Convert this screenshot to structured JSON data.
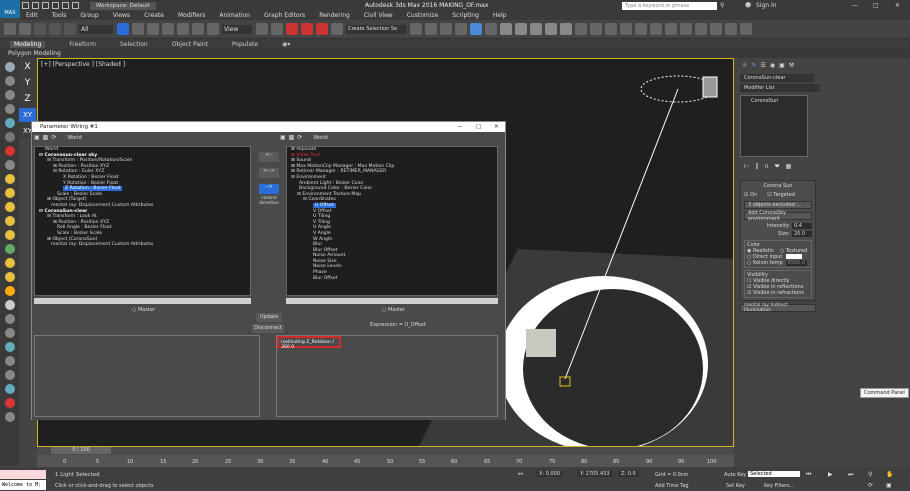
{
  "app": {
    "logo": "MAX",
    "title": "Autodesk 3ds Max 2016     MAKING_OF.max",
    "workspace": "Workspace: Default",
    "search_placeholder": "Type a keyword or phrase",
    "sign_in": "Sign In"
  },
  "menu": [
    "Edit",
    "Tools",
    "Group",
    "Views",
    "Create",
    "Modifiers",
    "Animation",
    "Graph Editors",
    "Rendering",
    "Civil View",
    "Customize",
    "Scripting",
    "Help"
  ],
  "toolbar": {
    "selection_filter": "All",
    "view_dropdown": "View",
    "selection_set": "Create Selection Se"
  },
  "ribbon": {
    "tabs": [
      "Modeling",
      "Freeform",
      "Selection",
      "Object Paint",
      "Populate"
    ],
    "sub": "Polygon Modeling"
  },
  "axes": [
    "X",
    "Y",
    "Z",
    "XY",
    "XY"
  ],
  "viewport": {
    "label": "[+] [Perspective ] [Shaded ]"
  },
  "command_panel": {
    "object_name": "CoronaSun-clear",
    "modifier_list": "Modifier List",
    "stack_item": "CoronaSun",
    "rollout": "Corona Sun",
    "on": "On",
    "targeted": "Targeted",
    "excluded": "3 objects excluded ...",
    "add_env": "Add CoronaSky environment",
    "intensity_label": "Intensity:",
    "intensity_value": "0.4",
    "size_label": "Size:",
    "size_value": "20.0",
    "color_section": "Color",
    "color_realistic": "Realistic",
    "color_textured": "Textured",
    "color_direct": "Direct input",
    "color_kelvin": "Kelvin temp",
    "kelvin_value": "6500.0",
    "visibility_section": "Visibility",
    "vis_direct": "Visible directly",
    "vis_refl": "Visible in reflections",
    "vis_refr": "Visible in refractions",
    "mental_ray": "mental ray Indirect Illumination",
    "tooltip": "Command Panel"
  },
  "dialog": {
    "title": "Parameter Wiring #1",
    "left_header": "World",
    "right_header": "World",
    "left_tree": [
      "World",
      "Coronasun-clear sky",
      "Transform : Position/Rotation/Scale",
      "Position : Position XYZ",
      "Rotation : Euler XYZ",
      "X Rotation : Bezier Float",
      "Y Rotation : Bezier Float",
      "Z Rotation : Bezier Float",
      "Scale : Bezier Scale",
      "Object (Target)",
      "mental ray: Displacement Custom Attributes",
      "CoronaSun-clear",
      "Transform : Look At",
      "Position : Position XYZ",
      "Roll Angle : Bezier Float",
      "Scale : Bezier Scale",
      "Object (CoronaSun)",
      "mental ray: Displacement Custom Attributes"
    ],
    "right_tree": [
      "Populate",
      "Video Post",
      "Sound",
      "Max MotionClip Manager : Max Motion Clip",
      "Retimer Manager : RETIMER_MANAGER",
      "Environment",
      "Ambient Light : Bezier Color",
      "Background Color : Bezier Color",
      "Environment Texture Map",
      "Coordinates",
      "U Offset",
      "V Offset",
      "U Tiling",
      "V Tiling",
      "U Angle",
      "V Angle",
      "W Angle",
      "Blur",
      "Blur Offset",
      "Noise Amount",
      "Noise Size",
      "Noise Levels",
      "Phase",
      "Blur Offset"
    ],
    "arrow_left": "<--",
    "arrow_both": "<-->",
    "arrow_right": "-->",
    "connect": "Connect",
    "direction": "control direction",
    "update": "Update",
    "disconnect": "Disconnect",
    "expression_label": "Expression = U_Offset",
    "left_expr": "",
    "right_expr": "(sellinding Z_Rotation / 360.0",
    "master_left": "Master",
    "master_right": "Master"
  },
  "timeline": {
    "frame": "0 / 100",
    "ticks": [
      "0",
      "5",
      "10",
      "15",
      "20",
      "25",
      "30",
      "35",
      "40",
      "45",
      "50",
      "55",
      "60",
      "65",
      "70",
      "75",
      "80",
      "85",
      "90",
      "95",
      "100"
    ]
  },
  "status": {
    "welcome": "Welcome to M:",
    "selected": "1 Light Selected",
    "hint": "Click or click-and-drag to select objects",
    "x": "X: 0.000",
    "y": "Y: 2705.433",
    "z": "Z: 0.0",
    "grid": "Grid = 0.0cm",
    "add_time_tag": "Add Time Tag",
    "auto_key": "Auto Key",
    "set_key": "Set Key",
    "key_mode": "Selected",
    "key_filters": "Key Filters..."
  },
  "colors": {
    "selection": "#2a6dd9",
    "viewport_border": "#d6b320",
    "highlight_red": "#e03030"
  }
}
